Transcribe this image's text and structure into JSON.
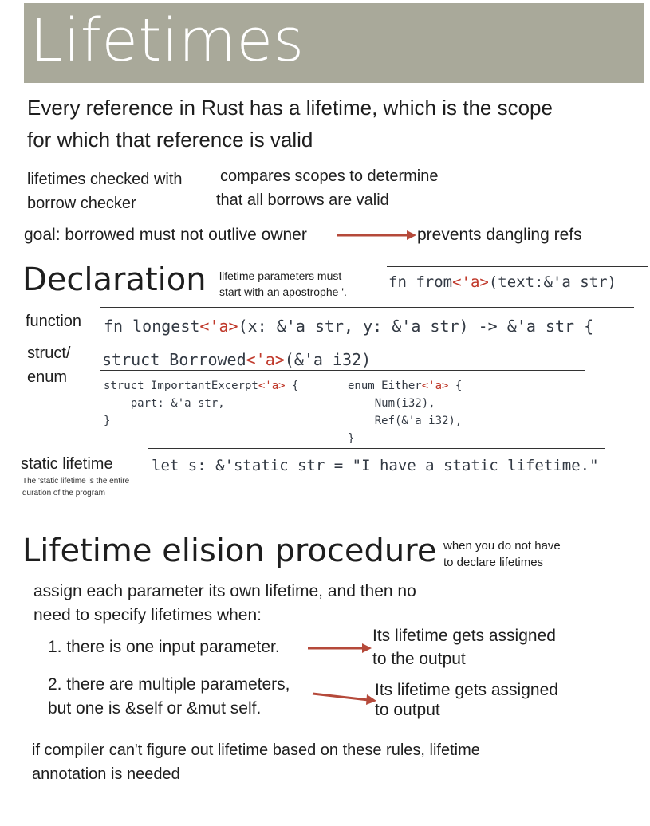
{
  "title": "Lifetimes",
  "intro": {
    "line1": "Every reference in Rust has a lifetime, which is the scope",
    "line2": "for which that reference is valid"
  },
  "checker": {
    "left_line1": "lifetimes checked with",
    "left_line2": "borrow checker",
    "right_line1": "compares scopes to determine",
    "right_line2": "that all borrows are valid"
  },
  "goal": {
    "text": "goal: borrowed must not outlive owner",
    "result": "prevents dangling refs"
  },
  "declaration": {
    "heading": "Declaration",
    "note_line1": "lifetime parameters must",
    "note_line2": "start with an apostrophe '.",
    "example": {
      "pre": "fn from",
      "lt": "<'a>",
      "mid": "(text:&'a str)"
    },
    "function_label": "function",
    "function_code": {
      "pre": "fn longest",
      "lt": "<'a>",
      "mid": "(x: &'a str, y: &'a str) -> &'a str {"
    },
    "struct_label_line1": "struct/",
    "struct_label_line2": "enum",
    "struct_code": {
      "pre": "struct Borrowed",
      "lt": "<'a>",
      "mid": "(&'a i32)"
    },
    "struct_block": {
      "l1_pre": "struct ImportantExcerpt",
      "l1_lt": "<'a>",
      "l1_post": " {",
      "l2": "    part: &'a str,",
      "l3": "}"
    },
    "enum_block": {
      "l1_pre": "enum Either",
      "l1_lt": "<'a>",
      "l1_post": " {",
      "l2": "    Num(i32),",
      "l3": "    Ref(&'a i32),",
      "l4": "}"
    },
    "static_label": "static lifetime",
    "static_note_line1": "The 'static lifetime is the entire",
    "static_note_line2": "duration of the program",
    "static_code": "let s: &'static str = \"I have a static lifetime.\""
  },
  "elision": {
    "heading": "Lifetime elision procedure",
    "note_line1": "when you do not have",
    "note_line2": "to declare lifetimes",
    "intro_line1": "assign each parameter its own lifetime, and then no",
    "intro_line2": "need to specify lifetimes when:",
    "rule1": "1. there is one input parameter.",
    "rule1_result_line1": "Its lifetime gets assigned",
    "rule1_result_line2": "to the output",
    "rule2_line1": "2. there are multiple parameters,",
    "rule2_line2": "but one is &self or &mut self.",
    "rule2_result_line1": "Its lifetime gets assigned",
    "rule2_result_line2": "to output",
    "footer_line1": "if compiler can't figure out lifetime based on these rules, lifetime",
    "footer_line2": "annotation is needed"
  },
  "colors": {
    "title_bar": "#a9a99a",
    "accent": "#c0392b",
    "arrow": "#b5493a",
    "code": "#333a44"
  }
}
